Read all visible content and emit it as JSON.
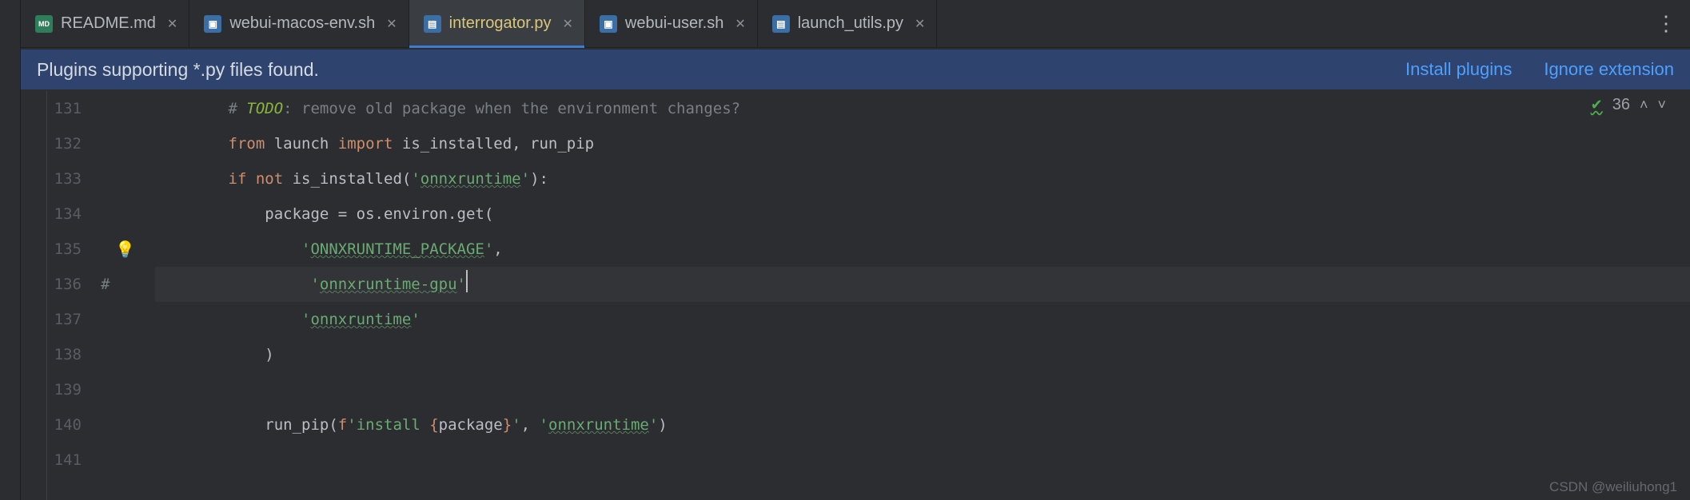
{
  "tabs": [
    {
      "icon": "md",
      "label": "README.md"
    },
    {
      "icon": "sh",
      "label": "webui-macos-env.sh"
    },
    {
      "icon": "py",
      "label": "interrogator.py"
    },
    {
      "icon": "sh",
      "label": "webui-user.sh"
    },
    {
      "icon": "py",
      "label": "launch_utils.py"
    }
  ],
  "banner": {
    "message": "Plugins supporting *.py files found.",
    "install": "Install plugins",
    "ignore": "Ignore extension"
  },
  "inspection": {
    "count": "36"
  },
  "gutter": {
    "lines": [
      "131",
      "132",
      "133",
      "134",
      "135",
      "136",
      "137",
      "138",
      "139",
      "140",
      "141"
    ],
    "comment_marker": "#",
    "bulb_line_index": 4
  },
  "code": {
    "l0": {
      "indent": "        ",
      "hash": "# ",
      "todo": "TODO",
      "rest": ": remove old package when the environment changes?"
    },
    "l1": {
      "indent": "        ",
      "kw1": "from ",
      "mod": "launch ",
      "kw2": "import ",
      "names": "is_installed, run_pip"
    },
    "l2": {
      "indent": "        ",
      "kw1": "if ",
      "kw2": "not ",
      "fn": "is_installed(",
      "q1": "'",
      "s": "onnxruntime",
      "q2": "'",
      "end": "):"
    },
    "l3": {
      "indent": "            ",
      "lhs": "package = os.environ.get("
    },
    "l4": {
      "indent": "                ",
      "q1": "'",
      "s": "ONNXRUNTIME_PACKAGE",
      "q2": "'",
      "comma": ","
    },
    "l5": {
      "indent": "                 ",
      "q1": "'",
      "s": "onnxruntime-gpu",
      "q2": "'"
    },
    "l6": {
      "indent": "                ",
      "q1": "'",
      "s": "onnxruntime",
      "q2": "'"
    },
    "l7": {
      "indent": "            ",
      "paren": ")"
    },
    "l8": {
      "indent": ""
    },
    "l9": {
      "indent": "            ",
      "fn": "run_pip(",
      "f": "f",
      "q1": "'",
      "s1": "install ",
      "br1": "{",
      "var": "package",
      "br2": "}",
      "q2": "'",
      "comma": ", ",
      "q3": "'",
      "s2": "onnxruntime",
      "q4": "'",
      "end": ")"
    },
    "l10": {
      "indent": ""
    }
  },
  "watermark": "CSDN @weiliuhong1"
}
